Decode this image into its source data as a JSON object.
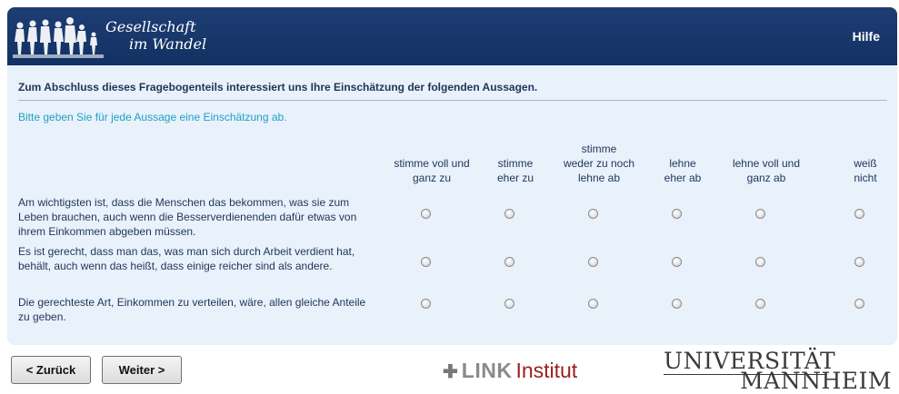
{
  "header": {
    "logo_line1": "Gesellschaft",
    "logo_line2": "im Wandel",
    "help_label": "Hilfe"
  },
  "intro_text": "Zum Abschluss dieses Fragebogenteils interessiert uns Ihre Einschätzung der folgenden Aussagen.",
  "instruction_text": "Bitte geben Sie für jede Aussage eine Einschätzung ab.",
  "columns": [
    {
      "label": "stimme voll und\nganz zu"
    },
    {
      "label": "stimme\neher zu"
    },
    {
      "label": "stimme\nweder zu noch\nlehne ab"
    },
    {
      "label": "lehne\neher ab"
    },
    {
      "label": "lehne voll und\nganz ab"
    },
    {
      "label": "weiß\nnicht"
    }
  ],
  "items": [
    {
      "text": "Am wichtigsten ist, dass die Menschen das bekommen, was sie zum Leben brauchen, auch wenn die Besserverdienenden dafür etwas von ihrem Einkommen abgeben müssen.",
      "selected": null
    },
    {
      "text": "Es ist gerecht, dass man das, was man sich durch Arbeit verdient hat, behält, auch wenn das heißt, dass einige reicher sind als andere.",
      "selected": null
    },
    {
      "text": "Die gerechteste Art, Einkommen zu verteilen, wäre, allen gleiche Anteile zu geben.",
      "selected": null
    }
  ],
  "buttons": {
    "back_label": "< Zurück",
    "next_label": "Weiter >"
  },
  "footer": {
    "link_brand": "LINK",
    "link_institut": "Institut",
    "uni_line1": "UNIVERSITÄT",
    "uni_line2": "MANNHEIM"
  },
  "icons": {
    "logo_figures": "people-silhouettes-icon",
    "link_cross": "link-cross-icon"
  },
  "colors": {
    "header_bg": "#1a3a6e",
    "panel_bg": "#e9f1fb",
    "instruction": "#1fa0c6",
    "text": "#1f3558"
  }
}
